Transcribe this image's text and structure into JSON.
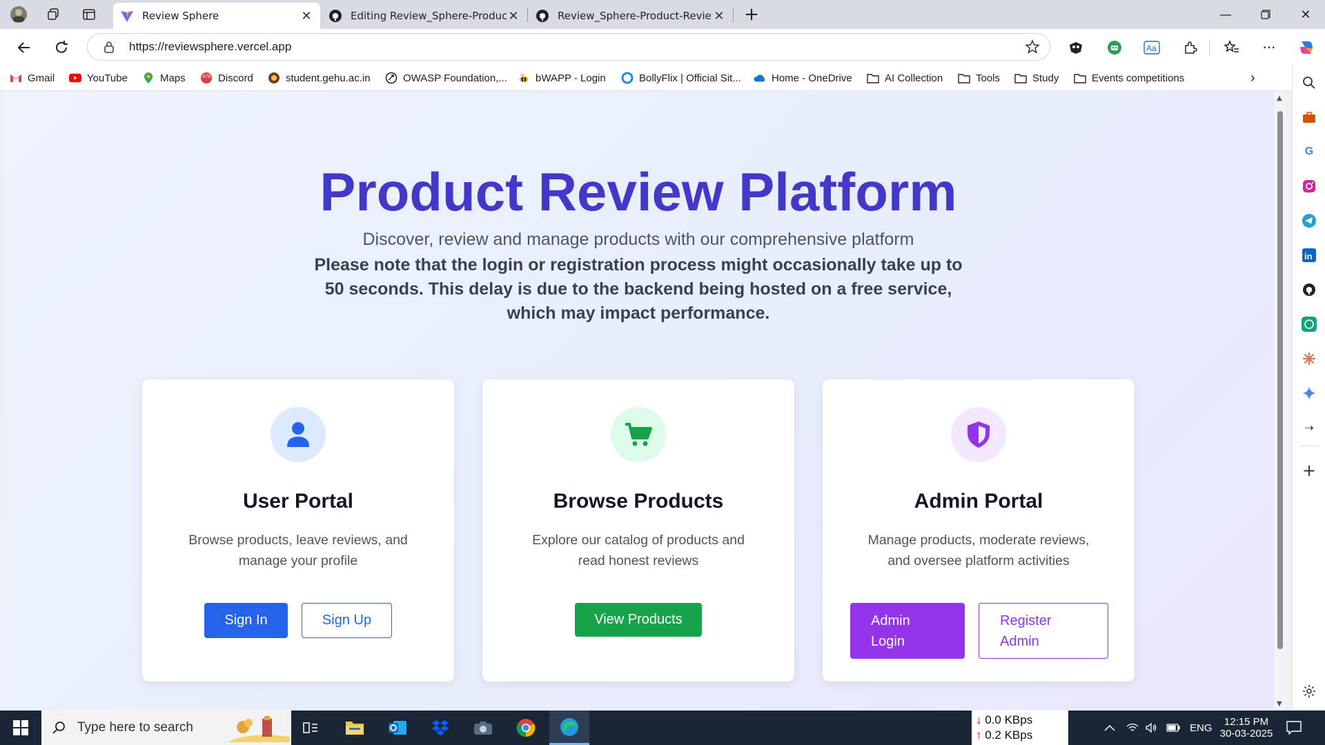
{
  "browser": {
    "tabs": [
      {
        "title": "Review Sphere",
        "active": true
      },
      {
        "title": "Editing Review_Sphere-Product-R",
        "active": false
      },
      {
        "title": "Review_Sphere-Product-Review-S",
        "active": false
      }
    ],
    "url": "https://reviewsphere.vercel.app",
    "bookmarks": [
      "Gmail",
      "YouTube",
      "Maps",
      "Discord",
      "student.gehu.ac.in",
      "OWASP Foundation,...",
      "bWAPP - Login",
      "BollyFlix | Official Sit...",
      "Home - OneDrive",
      "AI Collection",
      "Tools",
      "Study",
      "Events competitions"
    ],
    "discord_badge": "478"
  },
  "page": {
    "title": "Product Review Platform",
    "subtitle": "Discover, review and manage products with our comprehensive platform",
    "notice": "Please note that the login or registration process might occasionally take up to 50 seconds. This delay is due to the backend being hosted on a free service, which may impact performance.",
    "cards": {
      "user": {
        "title": "User Portal",
        "description": "Browse products, leave reviews, and manage your profile",
        "primary": "Sign In",
        "secondary": "Sign Up"
      },
      "browse": {
        "title": "Browse Products",
        "description": "Explore our catalog of products and read honest reviews",
        "primary": "View Products"
      },
      "admin": {
        "title": "Admin Portal",
        "description": "Manage products, moderate reviews, and oversee platform activities",
        "primary": "Admin Login",
        "secondary": "Register Admin"
      }
    },
    "colors": {
      "title": "#4338ca",
      "user": "#2563eb",
      "browse": "#16a34a",
      "admin": "#9333ea"
    }
  },
  "taskbar": {
    "search_placeholder": "Type here to search",
    "net_down": "0.0 KBps",
    "net_up": "0.2 KBps",
    "language": "ENG",
    "time": "12:15 PM",
    "date": "30-03-2025"
  }
}
